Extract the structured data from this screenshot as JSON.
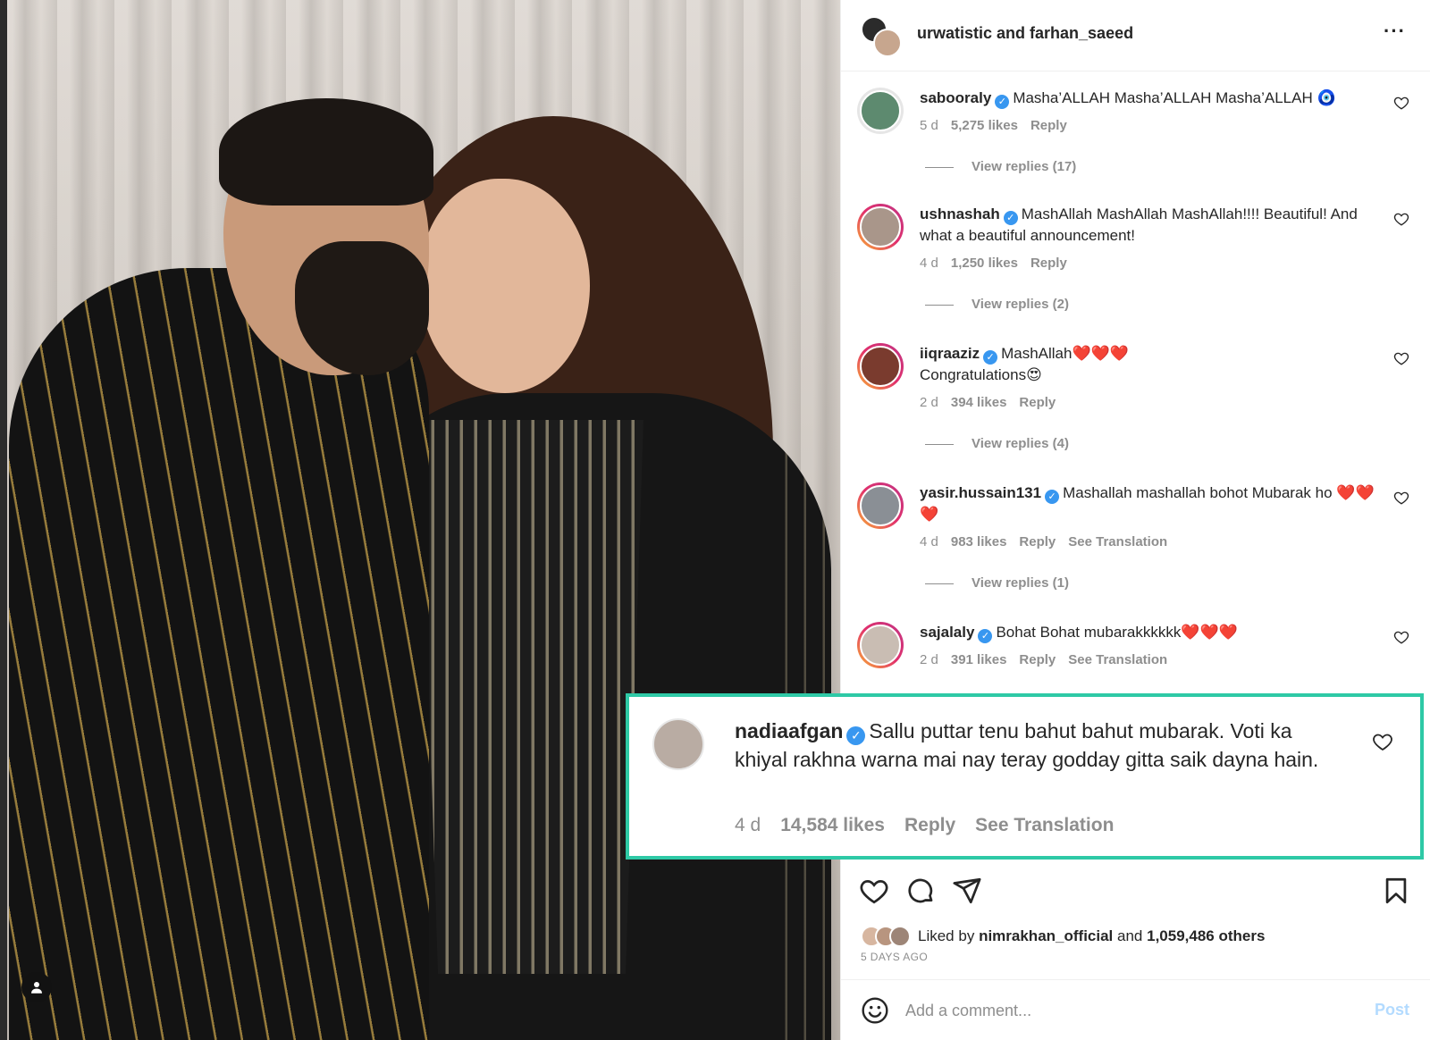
{
  "header": {
    "title": "urwatistic and farhan_saeed",
    "more_icon": "more-horizontal-icon"
  },
  "comments": [
    {
      "user": "sabooraly",
      "text": "Masha’ALLAH Masha’ALLAH Masha’ALLAH 🧿",
      "time": "5 d",
      "likes": "5,275 likes",
      "reply": "Reply",
      "view_replies": "View replies (17)"
    },
    {
      "user": "ushnashah",
      "text": "MashAllah MashAllah MashAllah!!!! Beautiful! And what a beautiful announcement!",
      "time": "4 d",
      "likes": "1,250 likes",
      "reply": "Reply",
      "view_replies": "View replies (2)"
    },
    {
      "user": "iiqraaziz",
      "text": "MashAllah❤️❤️❤️",
      "text2": "Congratulations😍",
      "time": "2 d",
      "likes": "394 likes",
      "reply": "Reply",
      "view_replies": "View replies (4)"
    },
    {
      "user": "yasir.hussain131",
      "text": "Mashallah mashallah bohot Mubarak ho ❤️❤️❤️",
      "time": "4 d",
      "likes": "983 likes",
      "reply": "Reply",
      "translate": "See Translation",
      "view_replies": "View replies (1)"
    },
    {
      "user": "sajalaly",
      "text": "Bohat Bohat mubarakkkkkk❤️❤️❤️",
      "time": "2 d",
      "likes": "391 likes",
      "reply": "Reply",
      "translate": "See Translation"
    }
  ],
  "highlight": {
    "user": "nadiaafgan",
    "text": "Sallu puttar tenu bahut bahut mubarak. Voti ka khiyal rakhna warna mai nay teray godday gitta saik dayna hain.",
    "time": "4 d",
    "likes": "14,584 likes",
    "reply": "Reply",
    "translate": "See Translation",
    "border_color": "#2ec9a6"
  },
  "likes_summary": {
    "prefix": "Liked by",
    "user": "nimrakhan_official",
    "joiner": "and",
    "others": "1,059,486 others",
    "posted": "5 DAYS AGO"
  },
  "composer": {
    "placeholder": "Add a comment...",
    "post_label": "Post"
  },
  "colors": {
    "verified": "#3897f0",
    "muted": "#8e8e8e",
    "post_disabled": "#b3dbff"
  }
}
